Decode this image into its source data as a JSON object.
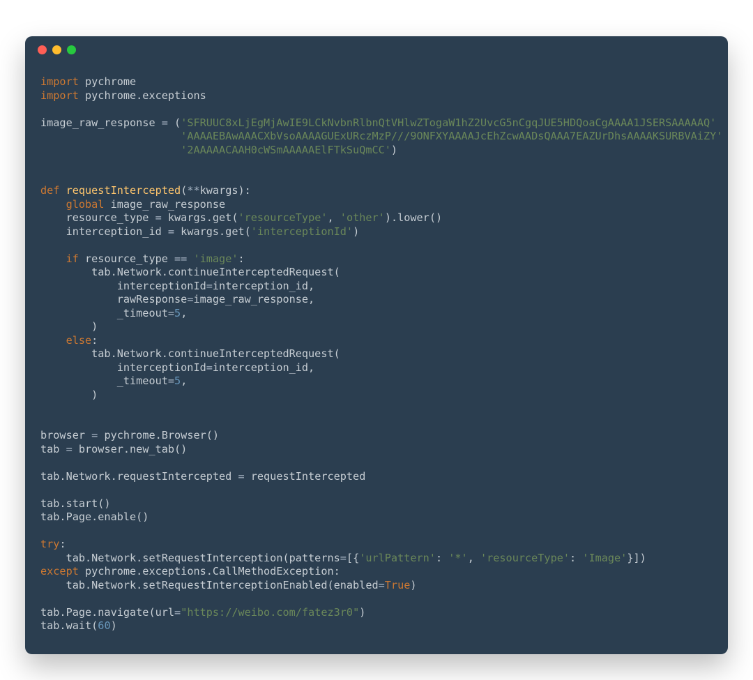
{
  "syntax": {
    "language": "python",
    "theme": "dark"
  },
  "titlebar": {
    "buttons": {
      "close": {
        "color": "#FF5F56",
        "name": "close"
      },
      "minimize": {
        "color": "#FFBD2E",
        "name": "minimize"
      },
      "zoom": {
        "color": "#27C93F",
        "name": "zoom"
      }
    }
  },
  "code": {
    "tokens": [
      [
        {
          "t": "kw",
          "v": "import"
        },
        {
          "t": "txt",
          "v": " pychrome"
        }
      ],
      [
        {
          "t": "kw",
          "v": "import"
        },
        {
          "t": "txt",
          "v": " pychrome.exceptions"
        }
      ],
      [],
      [
        {
          "t": "txt",
          "v": "image_raw_response "
        },
        {
          "t": "op",
          "v": "="
        },
        {
          "t": "txt",
          "v": " ("
        },
        {
          "t": "str",
          "v": "'SFRUUC8xLjEgMjAwIE9LCkNvbnRlbnQtVHlwZTogaW1hZ2UvcG5nCgqJUE5HDQoaCgAAAA1JSERSAAAAAQ'"
        }
      ],
      [
        {
          "t": "txt",
          "v": "                      "
        },
        {
          "t": "str",
          "v": "'AAAAEBAwAAACXbVsoAAAAGUExURczMzP///9ONFXYAAAAJcEhZcwAADsQAAA7EAZUrDhsAAAAKSURBVAiZY'"
        }
      ],
      [
        {
          "t": "txt",
          "v": "                      "
        },
        {
          "t": "str",
          "v": "'2AAAAACAAH0cWSmAAAAAElFTkSuQmCC'"
        },
        {
          "t": "txt",
          "v": ")"
        }
      ],
      [],
      [],
      [
        {
          "t": "kw",
          "v": "def"
        },
        {
          "t": "txt",
          "v": " "
        },
        {
          "t": "fnname",
          "v": "requestIntercepted"
        },
        {
          "t": "txt",
          "v": "("
        },
        {
          "t": "op",
          "v": "**"
        },
        {
          "t": "txt",
          "v": "kwargs):"
        }
      ],
      [
        {
          "t": "txt",
          "v": "    "
        },
        {
          "t": "kw",
          "v": "global"
        },
        {
          "t": "txt",
          "v": " image_raw_response"
        }
      ],
      [
        {
          "t": "txt",
          "v": "    resource_type "
        },
        {
          "t": "op",
          "v": "="
        },
        {
          "t": "txt",
          "v": " kwargs.get("
        },
        {
          "t": "str",
          "v": "'resourceType'"
        },
        {
          "t": "txt",
          "v": ", "
        },
        {
          "t": "str",
          "v": "'other'"
        },
        {
          "t": "txt",
          "v": ").lower()"
        }
      ],
      [
        {
          "t": "txt",
          "v": "    interception_id "
        },
        {
          "t": "op",
          "v": "="
        },
        {
          "t": "txt",
          "v": " kwargs.get("
        },
        {
          "t": "str",
          "v": "'interceptionId'"
        },
        {
          "t": "txt",
          "v": ")"
        }
      ],
      [],
      [
        {
          "t": "txt",
          "v": "    "
        },
        {
          "t": "kw",
          "v": "if"
        },
        {
          "t": "txt",
          "v": " resource_type "
        },
        {
          "t": "op",
          "v": "=="
        },
        {
          "t": "txt",
          "v": " "
        },
        {
          "t": "str",
          "v": "'image'"
        },
        {
          "t": "txt",
          "v": ":"
        }
      ],
      [
        {
          "t": "txt",
          "v": "        tab.Network.continueInterceptedRequest("
        }
      ],
      [
        {
          "t": "txt",
          "v": "            interceptionId"
        },
        {
          "t": "op",
          "v": "="
        },
        {
          "t": "txt",
          "v": "interception_id,"
        }
      ],
      [
        {
          "t": "txt",
          "v": "            rawResponse"
        },
        {
          "t": "op",
          "v": "="
        },
        {
          "t": "txt",
          "v": "image_raw_response,"
        }
      ],
      [
        {
          "t": "txt",
          "v": "            _timeout"
        },
        {
          "t": "op",
          "v": "="
        },
        {
          "t": "num",
          "v": "5"
        },
        {
          "t": "txt",
          "v": ","
        }
      ],
      [
        {
          "t": "txt",
          "v": "        )"
        }
      ],
      [
        {
          "t": "txt",
          "v": "    "
        },
        {
          "t": "kw",
          "v": "else"
        },
        {
          "t": "txt",
          "v": ":"
        }
      ],
      [
        {
          "t": "txt",
          "v": "        tab.Network.continueInterceptedRequest("
        }
      ],
      [
        {
          "t": "txt",
          "v": "            interceptionId"
        },
        {
          "t": "op",
          "v": "="
        },
        {
          "t": "txt",
          "v": "interception_id,"
        }
      ],
      [
        {
          "t": "txt",
          "v": "            _timeout"
        },
        {
          "t": "op",
          "v": "="
        },
        {
          "t": "num",
          "v": "5"
        },
        {
          "t": "txt",
          "v": ","
        }
      ],
      [
        {
          "t": "txt",
          "v": "        )"
        }
      ],
      [],
      [],
      [
        {
          "t": "txt",
          "v": "browser "
        },
        {
          "t": "op",
          "v": "="
        },
        {
          "t": "txt",
          "v": " pychrome.Browser()"
        }
      ],
      [
        {
          "t": "txt",
          "v": "tab "
        },
        {
          "t": "op",
          "v": "="
        },
        {
          "t": "txt",
          "v": " browser.new_tab()"
        }
      ],
      [],
      [
        {
          "t": "txt",
          "v": "tab.Network.requestIntercepted "
        },
        {
          "t": "op",
          "v": "="
        },
        {
          "t": "txt",
          "v": " requestIntercepted"
        }
      ],
      [],
      [
        {
          "t": "txt",
          "v": "tab.start()"
        }
      ],
      [
        {
          "t": "txt",
          "v": "tab.Page.enable()"
        }
      ],
      [],
      [
        {
          "t": "kw",
          "v": "try"
        },
        {
          "t": "txt",
          "v": ":"
        }
      ],
      [
        {
          "t": "txt",
          "v": "    tab.Network.setRequestInterception(patterns"
        },
        {
          "t": "op",
          "v": "="
        },
        {
          "t": "txt",
          "v": "[{"
        },
        {
          "t": "str",
          "v": "'urlPattern'"
        },
        {
          "t": "txt",
          "v": ": "
        },
        {
          "t": "str",
          "v": "'*'"
        },
        {
          "t": "txt",
          "v": ", "
        },
        {
          "t": "str",
          "v": "'resourceType'"
        },
        {
          "t": "txt",
          "v": ": "
        },
        {
          "t": "str",
          "v": "'Image'"
        },
        {
          "t": "txt",
          "v": "}])"
        }
      ],
      [
        {
          "t": "kw",
          "v": "except"
        },
        {
          "t": "txt",
          "v": " pychrome.exceptions.CallMethodException:"
        }
      ],
      [
        {
          "t": "txt",
          "v": "    tab.Network.setRequestInterceptionEnabled(enabled"
        },
        {
          "t": "op",
          "v": "="
        },
        {
          "t": "kw",
          "v": "True"
        },
        {
          "t": "txt",
          "v": ")"
        }
      ],
      [],
      [
        {
          "t": "txt",
          "v": "tab.Page.navigate(url"
        },
        {
          "t": "op",
          "v": "="
        },
        {
          "t": "strd",
          "v": "\"https://weibo.com/fatez3r0\""
        },
        {
          "t": "txt",
          "v": ")"
        }
      ],
      [
        {
          "t": "txt",
          "v": "tab.wait("
        },
        {
          "t": "num",
          "v": "60"
        },
        {
          "t": "txt",
          "v": ")"
        }
      ]
    ]
  }
}
